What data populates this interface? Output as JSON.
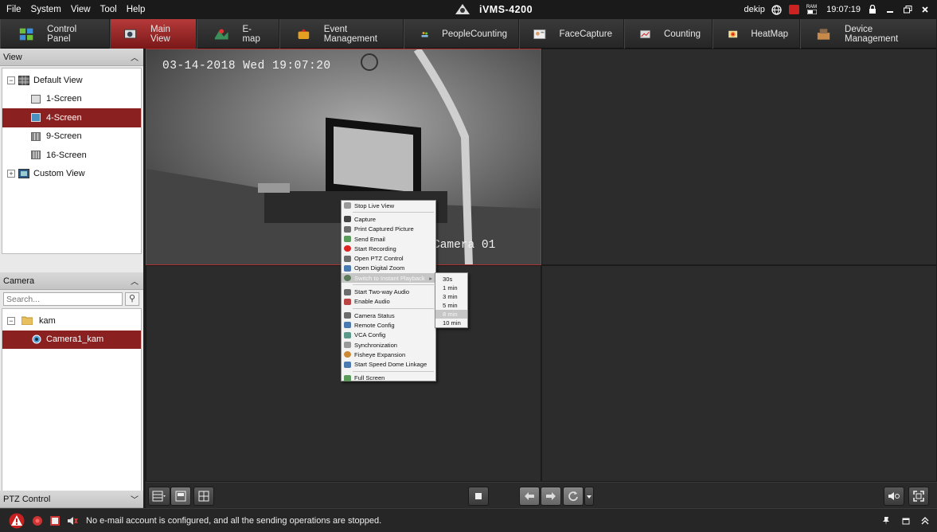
{
  "titlebar": {
    "menu": [
      "File",
      "System",
      "View",
      "Tool",
      "Help"
    ],
    "app_title": "iVMS-4200",
    "user": "dekip",
    "time": "19:07:19",
    "ram_label": "RAM"
  },
  "toolbar": {
    "tabs": [
      {
        "label": "Control Panel",
        "icon": "control-panel-icon"
      },
      {
        "label": "Main View",
        "icon": "main-view-icon"
      },
      {
        "label": "E-map",
        "icon": "emap-icon"
      },
      {
        "label": "Event Management",
        "icon": "event-management-icon"
      },
      {
        "label": "PeopleCounting",
        "icon": "people-counting-icon"
      },
      {
        "label": "FaceCapture",
        "icon": "face-capture-icon"
      },
      {
        "label": "Counting",
        "icon": "counting-icon"
      },
      {
        "label": "HeatMap",
        "icon": "heatmap-icon"
      },
      {
        "label": "Device Management",
        "icon": "device-management-icon"
      }
    ],
    "active_tab": "Main View"
  },
  "view_panel": {
    "title": "View",
    "items": [
      {
        "label": "Default View",
        "expander": "−"
      },
      {
        "label": "1-Screen"
      },
      {
        "label": "4-Screen",
        "selected": true
      },
      {
        "label": "9-Screen"
      },
      {
        "label": "16-Screen"
      },
      {
        "label": "Custom View",
        "expander": "+"
      }
    ]
  },
  "camera_panel": {
    "title": "Camera",
    "search_placeholder": "Search...",
    "group": "kam",
    "group_expander": "−",
    "camera": "Camera1_kam"
  },
  "ptz_panel": {
    "title": "PTZ Control"
  },
  "video": {
    "osd_timestamp": "03-14-2018 Wed 19:07:20",
    "osd_camera": "Camera 01"
  },
  "context_menu": {
    "items": [
      "Stop Live View",
      "Capture",
      "Print Captured Picture",
      "Send Email",
      "Start Recording",
      "Open PTZ Control",
      "Open Digital Zoom",
      "Switch to Instant Playback",
      "Start Two-way Audio",
      "Enable Audio",
      "Camera Status",
      "Remote Config",
      "VCA Config",
      "Synchronization",
      "Fisheye Expansion",
      "Start Speed Dome Linkage",
      "Full Screen"
    ],
    "highlighted": "Switch to Instant Playback",
    "submenu_arrow": "▸"
  },
  "submenu": {
    "items": [
      "30s",
      "1 min",
      "3 min",
      "5 min",
      "8 min",
      "10 min"
    ],
    "highlighted": "8 min"
  },
  "statusbar": {
    "message": "No e-mail account is configured, and all the sending operations are stopped."
  },
  "colors": {
    "accent": "#8b2020",
    "active_tab_top": "#b63a3a",
    "background": "#2c2c2c"
  }
}
